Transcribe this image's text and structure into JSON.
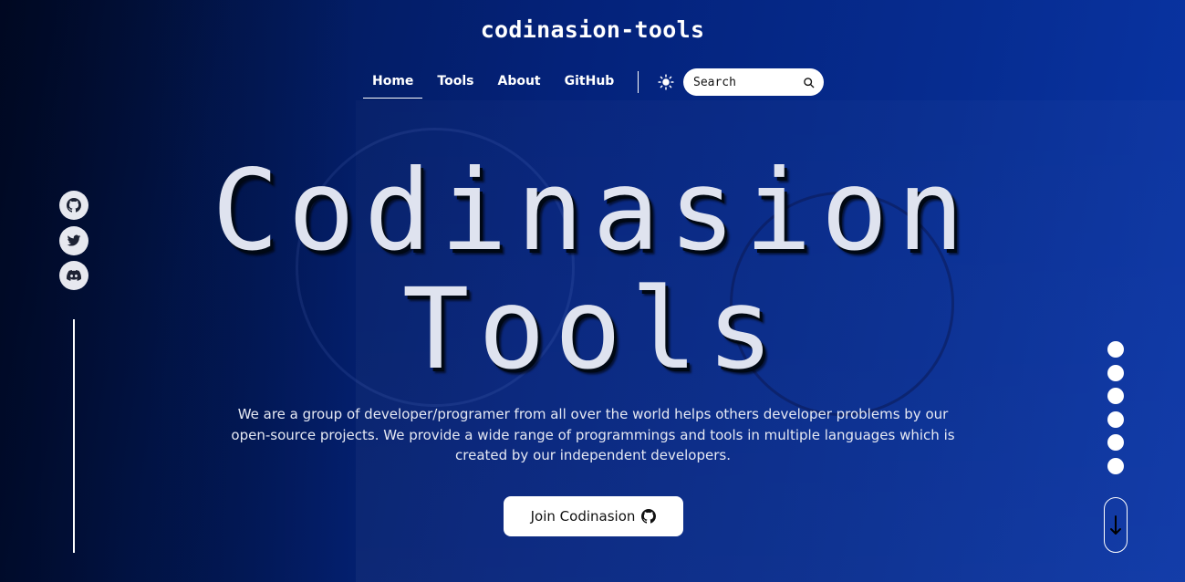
{
  "header": {
    "brand": "codinasion-tools"
  },
  "nav": {
    "items": [
      {
        "label": "Home",
        "active": true
      },
      {
        "label": "Tools",
        "active": false
      },
      {
        "label": "About",
        "active": false
      },
      {
        "label": "GitHub",
        "active": false
      }
    ],
    "theme_toggle_icon": "sun-icon"
  },
  "search": {
    "placeholder": "Search",
    "icon": "search-icon"
  },
  "hero": {
    "title_line1": "Codinasion",
    "title_line2": "Tools",
    "description": "We are a group of developer/programer from all over the world helps others developer problems by our open-source projects. We provide a wide range of programmings and tools in multiple languages which is created by our independent developers.",
    "cta_label": "Join Codinasion",
    "cta_icon": "github-icon"
  },
  "social": {
    "links": [
      "github-icon",
      "twitter-icon",
      "discord-icon"
    ]
  },
  "page_indicator": {
    "count": 6
  },
  "scroll_indicator": {
    "icon": "arrow-down-icon"
  },
  "colors": {
    "background_dark": "#000c2b",
    "background_accent": "#0a35a6",
    "text": "#ffffff",
    "title_fill": "#dfe3ef"
  }
}
